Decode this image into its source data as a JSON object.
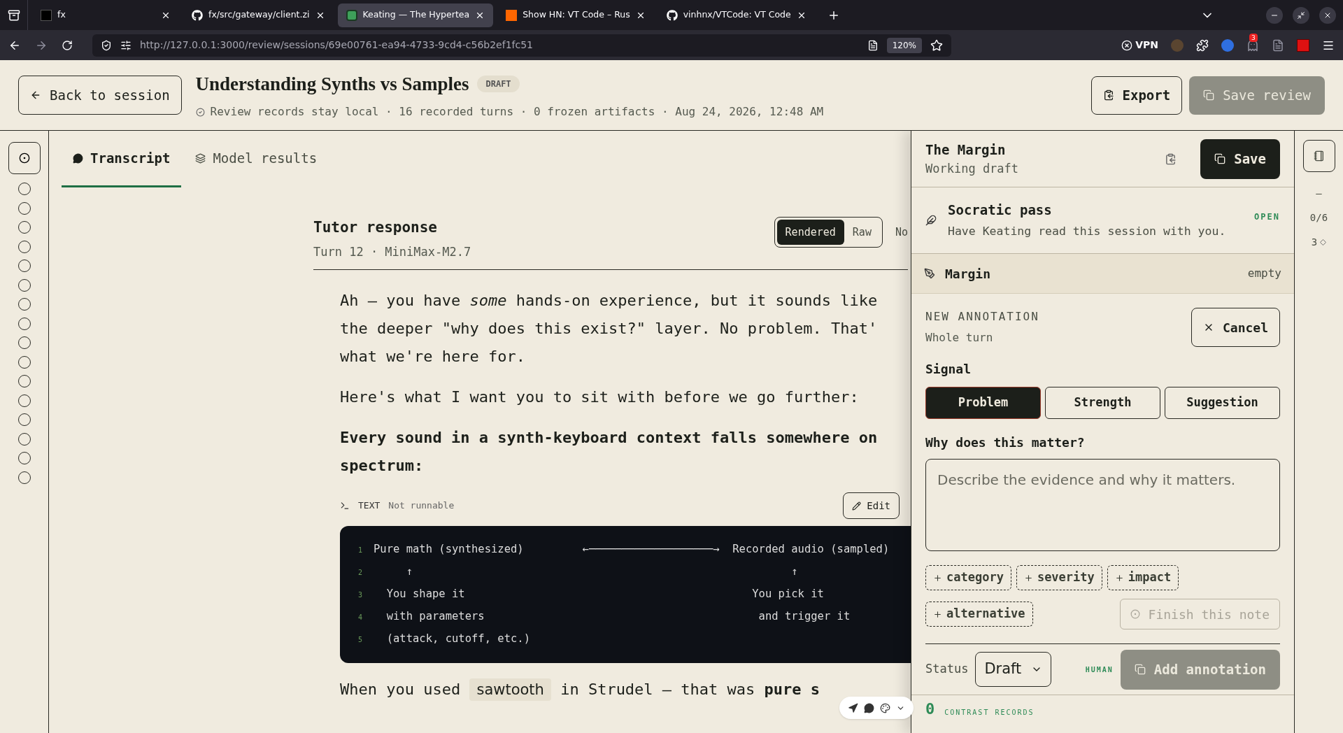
{
  "browser": {
    "tabs": [
      {
        "title": "fx",
        "selected": false,
        "kind": "fx"
      },
      {
        "title": "fx/src/gateway/client.zi",
        "selected": false,
        "kind": "github"
      },
      {
        "title": "Keating — The Hypertea",
        "selected": true,
        "kind": "keating"
      },
      {
        "title": "Show HN: VT Code – Rus",
        "selected": false,
        "kind": "hn"
      },
      {
        "title": "vinhnx/VTCode: VT Code",
        "selected": false,
        "kind": "github"
      }
    ],
    "url": "http://127.0.0.1:3000/review/sessions/69e00761-ea94-4733-9cd4-c56b2ef1fc51",
    "zoom": "120%",
    "vpn": "VPN",
    "notification_count": "3"
  },
  "header": {
    "back": "Back to session",
    "title": "Understanding Synths vs Samples",
    "badge": "DRAFT",
    "meta": "Review records stay local · 16 recorded turns · 0 frozen artifacts · Aug 24, 2026, 12:48 AM",
    "actions": [
      {
        "label": "Export",
        "kind": "outline"
      },
      {
        "label": "Save review",
        "kind": "muted"
      }
    ]
  },
  "turn_rail": {
    "turns": [
      {
        "selected": false
      },
      {
        "selected": false
      },
      {
        "selected": false
      },
      {
        "selected": false
      },
      {
        "selected": false
      },
      {
        "selected": false
      },
      {
        "selected": false
      },
      {
        "selected": false
      },
      {
        "selected": false
      },
      {
        "selected": false
      },
      {
        "selected": false
      },
      {
        "selected": false
      },
      {
        "selected": false
      },
      {
        "selected": false
      },
      {
        "selected": false
      },
      {
        "selected": false
      }
    ]
  },
  "tabs": [
    {
      "label": "Transcript",
      "selected": true,
      "kind": "chat"
    },
    {
      "label": "Model results",
      "selected": false,
      "kind": "layers"
    }
  ],
  "response": {
    "title": "Tutor response",
    "meta": "Turn 12 · MiniMax-M2.7",
    "view_modes": [
      {
        "label": "Rendered",
        "selected": true
      },
      {
        "label": "Raw",
        "selected": false
      }
    ],
    "cut_label": "No",
    "blocks": [
      {
        "kind": "text",
        "lines": [
          "Ah — you have *some* hands-on experience, but it sounds like",
          "the deeper \"why does this exist?\" layer. No problem. That'",
          "what we're here for."
        ]
      },
      {
        "kind": "text",
        "lines": [
          "Here's what I want you to sit with before we go further:"
        ]
      },
      {
        "kind": "strong",
        "lines": [
          "Every sound in a synth-keyboard context falls somewhere on",
          "spectrum:"
        ]
      },
      {
        "kind": "code",
        "lang": "TEXT",
        "note": "Not runnable",
        "edit": "Edit",
        "lines": [
          {
            "number": "1",
            "text": "Pure math (synthesized)         ←───────────────────→  Recorded audio (sampled)"
          },
          {
            "number": "2",
            "text": "     ↑                                                          ↑"
          },
          {
            "number": "3",
            "text": "  You shape it                                            You pick it"
          },
          {
            "number": "4",
            "text": "  with parameters                                          and trigger it"
          },
          {
            "number": "5",
            "text": "  (attack, cutoff, etc.)"
          }
        ]
      },
      {
        "kind": "inline_code",
        "before": "When you used",
        "code": "sawtooth",
        "after": "in Strudel — that was **pure s**"
      }
    ]
  },
  "margin_panel": {
    "title": "The Margin",
    "subtitle": "Working draft",
    "save": "Save",
    "socratic": {
      "title": "Socratic pass",
      "text": "Have Keating read this session with you.",
      "status": "OPEN"
    },
    "section": {
      "title": "Margin",
      "state": "empty"
    },
    "annotation": {
      "heading": "NEW ANNOTATION",
      "scope": "Whole turn",
      "cancel": "Cancel",
      "signal_label": "Signal",
      "signals": [
        {
          "label": "Problem",
          "selected": true
        },
        {
          "label": "Strength",
          "selected": false
        },
        {
          "label": "Suggestion",
          "selected": false
        }
      ],
      "question": "Why does this matter?",
      "placeholder": "Describe the evidence and why it matters.",
      "chips": [
        "category",
        "severity",
        "impact",
        "alternative"
      ],
      "finish": "Finish this note",
      "status_label": "Status",
      "status": "Draft",
      "author": "HUMAN",
      "add": "Add annotation"
    },
    "contrast": {
      "count": "0",
      "label": "CONTRAST RECORDS"
    }
  },
  "side_rail": {
    "dash": "–",
    "progress": "0/6",
    "count": "3"
  }
}
